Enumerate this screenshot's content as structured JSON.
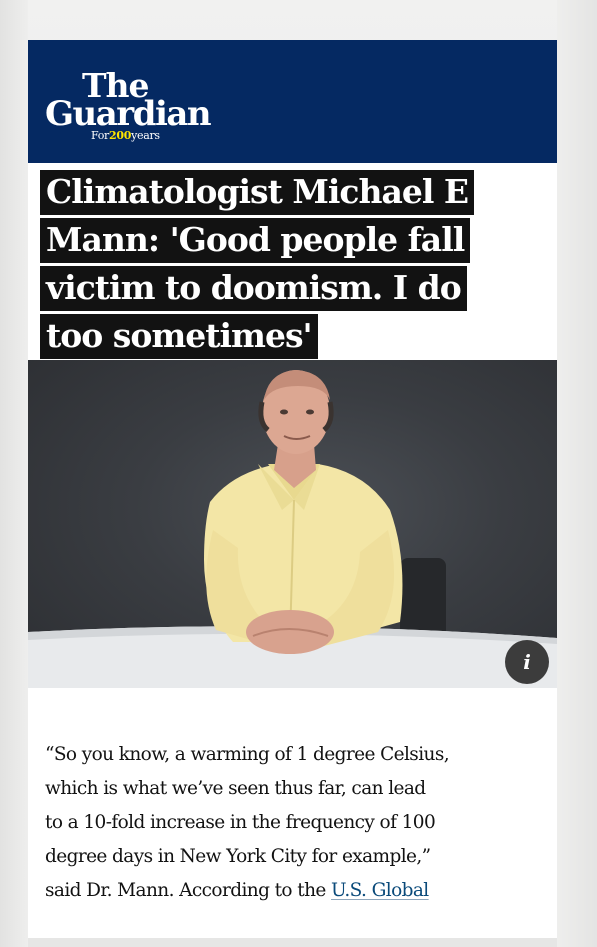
{
  "masthead": {
    "logo_the": "The",
    "logo_guardian": "Guardian",
    "tagline_prefix": "For",
    "tagline_number": "200",
    "tagline_suffix": "years",
    "background_color": "#052962",
    "accent_color": "#ffe500"
  },
  "article": {
    "headline_lines": [
      "Climatologist Michael E",
      "Mann: 'Good people fall",
      "victim to doomism. I do",
      "too sometimes'"
    ],
    "image_info_icon": "info-icon",
    "body_lines": [
      "“So you know, a warming of 1 degree Celsius,",
      "which is what we’ve seen thus far, can lead",
      "to a 10-fold increase in the frequency of 100",
      "degree days in New York City for example,”"
    ],
    "body_last_line_text": "said Dr. Mann. According to the ",
    "body_link_text": "U.S. Global",
    "link_color": "#0a4a7a"
  }
}
